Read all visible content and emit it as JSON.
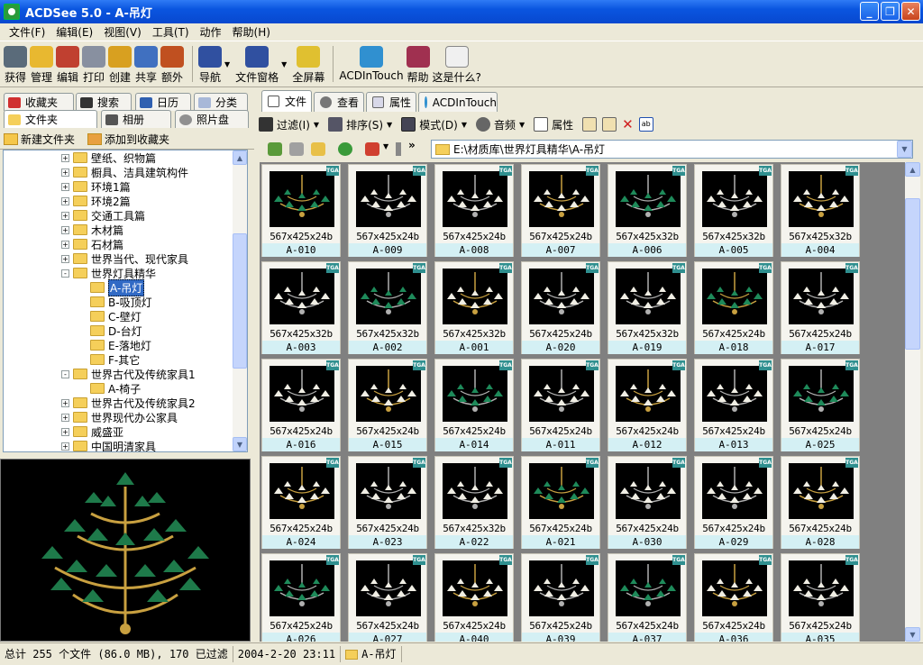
{
  "window": {
    "title": "ACDSee 5.0 - A-吊灯",
    "minimize": "_",
    "maximize": "❐",
    "close": "✕"
  },
  "menu": [
    "文件(F)",
    "编辑(E)",
    "视图(V)",
    "工具(T)",
    "动作",
    "帮助(H)"
  ],
  "toolbar": [
    {
      "label": "获得",
      "icon": "acquire-icon",
      "color": "#5A6B7A"
    },
    {
      "label": "管理",
      "icon": "manage-icon",
      "color": "#E8B830"
    },
    {
      "label": "编辑",
      "icon": "edit-icon",
      "color": "#C04030"
    },
    {
      "label": "打印",
      "icon": "print-icon",
      "color": "#8890A0"
    },
    {
      "label": "创建",
      "icon": "create-icon",
      "color": "#D8A020"
    },
    {
      "label": "共享",
      "icon": "share-icon",
      "color": "#4070C0"
    },
    {
      "label": "额外",
      "icon": "extras-icon",
      "color": "#C05020"
    },
    {
      "label": "导航",
      "icon": "navigation-icon",
      "color": "#3050A0"
    },
    {
      "label": "文件窗格",
      "icon": "file-pane-icon",
      "color": "#3050A0"
    },
    {
      "label": "全屏幕",
      "icon": "fullscreen-icon",
      "color": "#E0C030"
    },
    {
      "label": "ACDInTouch",
      "icon": "acdintouch-icon",
      "color": "#3090D0"
    },
    {
      "label": "帮助",
      "icon": "help-book-icon",
      "color": "#A03050"
    },
    {
      "label": "这是什么?",
      "icon": "whats-this-icon",
      "color": "#F0F0F0"
    }
  ],
  "left_tabs": {
    "favorites": "收藏夹",
    "search": "搜索",
    "calendar": "日历",
    "category": "分类",
    "folders": "文件夹",
    "album": "相册",
    "photodisc": "照片盘"
  },
  "folder_bar": {
    "new_folder": "新建文件夹",
    "add_favorites": "添加到收藏夹"
  },
  "tree": [
    {
      "label": "壁纸、织物篇",
      "level": 0,
      "expander": "+"
    },
    {
      "label": "橱具、洁具建筑构件",
      "level": 0,
      "expander": "+"
    },
    {
      "label": "环境1篇",
      "level": 0,
      "expander": "+"
    },
    {
      "label": "环境2篇",
      "level": 0,
      "expander": "+"
    },
    {
      "label": "交通工具篇",
      "level": 0,
      "expander": "+"
    },
    {
      "label": "木材篇",
      "level": 0,
      "expander": "+"
    },
    {
      "label": "石材篇",
      "level": 0,
      "expander": "+"
    },
    {
      "label": "世界当代、现代家具",
      "level": 0,
      "expander": "+"
    },
    {
      "label": "世界灯具精华",
      "level": 0,
      "expander": "-"
    },
    {
      "label": "A-吊灯",
      "level": 1,
      "expander": "",
      "selected": true
    },
    {
      "label": "B-吸顶灯",
      "level": 1,
      "expander": ""
    },
    {
      "label": "C-壁灯",
      "level": 1,
      "expander": ""
    },
    {
      "label": "D-台灯",
      "level": 1,
      "expander": ""
    },
    {
      "label": "E-落地灯",
      "level": 1,
      "expander": ""
    },
    {
      "label": "F-其它",
      "level": 1,
      "expander": ""
    },
    {
      "label": "世界古代及传统家具1",
      "level": 0,
      "expander": "-"
    },
    {
      "label": "A-椅子",
      "level": 1,
      "expander": ""
    },
    {
      "label": "世界古代及传统家具2",
      "level": 0,
      "expander": "+"
    },
    {
      "label": "世界现代办公家具",
      "level": 0,
      "expander": "+"
    },
    {
      "label": "威盛亚",
      "level": 0,
      "expander": "+"
    },
    {
      "label": "中国明清家具",
      "level": 0,
      "expander": "+"
    }
  ],
  "right_tabs": {
    "file": "文件",
    "view": "查看",
    "properties": "属性",
    "acdintouch": "ACDInTouch"
  },
  "file_toolbar": {
    "filter": "过滤(I)",
    "sort": "排序(S)",
    "mode": "模式(D)",
    "audio": "音频",
    "properties": "属性"
  },
  "address": "E:\\材质库\\世界灯具精华\\A-吊灯",
  "badge": "TGA",
  "thumbnails": [
    {
      "name": "A-010",
      "dim": "567x425x24b"
    },
    {
      "name": "A-009",
      "dim": "567x425x24b"
    },
    {
      "name": "A-008",
      "dim": "567x425x24b"
    },
    {
      "name": "A-007",
      "dim": "567x425x24b"
    },
    {
      "name": "A-006",
      "dim": "567x425x32b"
    },
    {
      "name": "A-005",
      "dim": "567x425x32b"
    },
    {
      "name": "A-004",
      "dim": "567x425x32b"
    },
    {
      "name": "A-003",
      "dim": "567x425x32b"
    },
    {
      "name": "A-002",
      "dim": "567x425x32b"
    },
    {
      "name": "A-001",
      "dim": "567x425x32b"
    },
    {
      "name": "A-020",
      "dim": "567x425x24b"
    },
    {
      "name": "A-019",
      "dim": "567x425x32b"
    },
    {
      "name": "A-018",
      "dim": "567x425x24b"
    },
    {
      "name": "A-017",
      "dim": "567x425x24b"
    },
    {
      "name": "A-016",
      "dim": "567x425x24b"
    },
    {
      "name": "A-015",
      "dim": "567x425x24b"
    },
    {
      "name": "A-014",
      "dim": "567x425x24b"
    },
    {
      "name": "A-011",
      "dim": "567x425x24b"
    },
    {
      "name": "A-012",
      "dim": "567x425x24b"
    },
    {
      "name": "A-013",
      "dim": "567x425x24b"
    },
    {
      "name": "A-025",
      "dim": "567x425x24b"
    },
    {
      "name": "A-024",
      "dim": "567x425x24b"
    },
    {
      "name": "A-023",
      "dim": "567x425x24b"
    },
    {
      "name": "A-022",
      "dim": "567x425x32b"
    },
    {
      "name": "A-021",
      "dim": "567x425x24b"
    },
    {
      "name": "A-030",
      "dim": "567x425x24b"
    },
    {
      "name": "A-029",
      "dim": "567x425x24b"
    },
    {
      "name": "A-028",
      "dim": "567x425x24b"
    },
    {
      "name": "A-026",
      "dim": "567x425x24b"
    },
    {
      "name": "A-027",
      "dim": "567x425x24b"
    },
    {
      "name": "A-040",
      "dim": "567x425x24b"
    },
    {
      "name": "A-039",
      "dim": "567x425x24b"
    },
    {
      "name": "A-037",
      "dim": "567x425x24b"
    },
    {
      "name": "A-036",
      "dim": "567x425x24b"
    },
    {
      "name": "A-035",
      "dim": "567x425x24b"
    }
  ],
  "status": {
    "summary": "总计 255 个文件 (86.0 MB), 170 已过滤",
    "date": "2004-2-20 23:11",
    "folder": "A-吊灯"
  },
  "colors": {
    "titlebar": "#0A55DF",
    "selection": "#316AC5",
    "thumb_label": "#D4F0F4",
    "chrome": "#ECE9D8"
  }
}
